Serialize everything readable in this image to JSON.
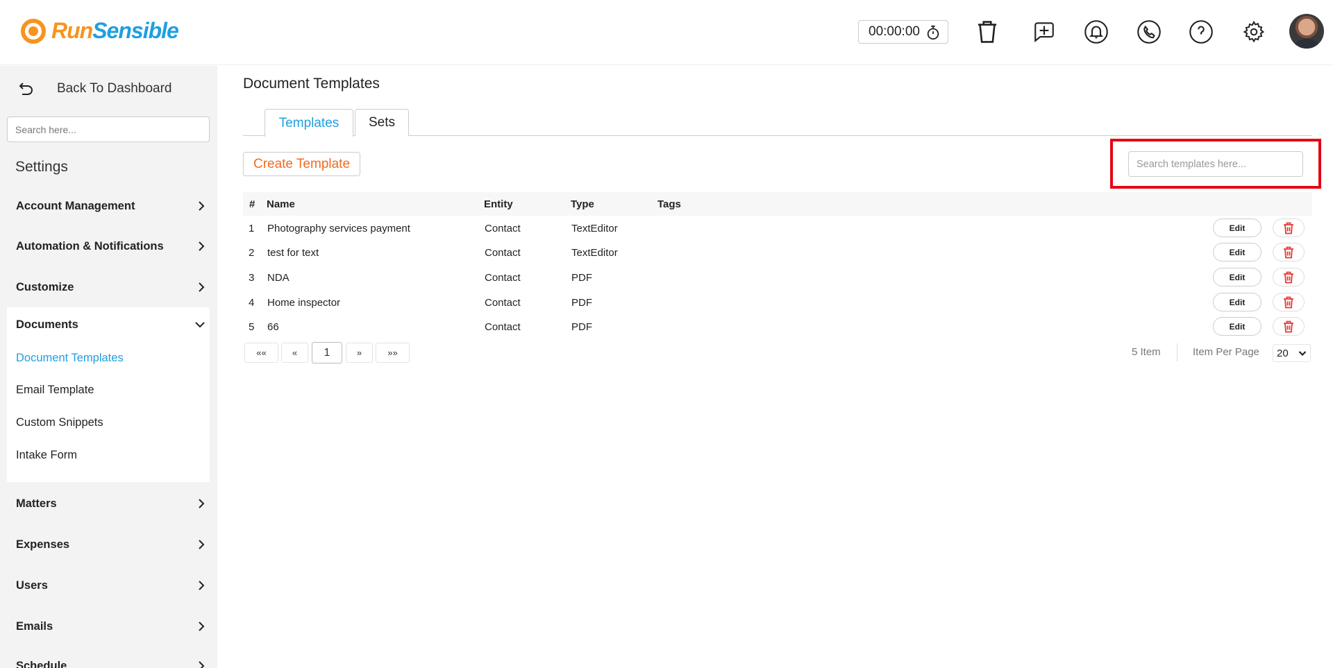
{
  "brand": {
    "part1": "Run",
    "part2": "Sensible"
  },
  "header": {
    "timer": "00:00:00"
  },
  "sidebar": {
    "back_label": "Back To Dashboard",
    "search_placeholder": "Search here...",
    "title": "Settings",
    "items": [
      {
        "label": "Account Management"
      },
      {
        "label": "Automation & Notifications"
      },
      {
        "label": "Customize"
      },
      {
        "label": "Documents"
      },
      {
        "label": "Matters"
      },
      {
        "label": "Expenses"
      },
      {
        "label": "Users"
      },
      {
        "label": "Emails"
      },
      {
        "label": "Schedule"
      }
    ],
    "documents_sub": [
      {
        "label": "Document Templates",
        "active": true
      },
      {
        "label": "Email Template"
      },
      {
        "label": "Custom Snippets"
      },
      {
        "label": "Intake Form"
      }
    ]
  },
  "main": {
    "title": "Document Templates",
    "tabs": [
      {
        "label": "Templates",
        "active": true
      },
      {
        "label": "Sets"
      }
    ],
    "create_label": "Create Template",
    "search_placeholder": "Search templates here...",
    "columns": {
      "num": "#",
      "name": "Name",
      "entity": "Entity",
      "type": "Type",
      "tags": "Tags"
    },
    "rows": [
      {
        "num": "1",
        "name": "Photography services payment",
        "entity": "Contact",
        "type": "TextEditor",
        "tags": ""
      },
      {
        "num": "2",
        "name": "test for text",
        "entity": "Contact",
        "type": "TextEditor",
        "tags": ""
      },
      {
        "num": "3",
        "name": "NDA",
        "entity": "Contact",
        "type": "PDF",
        "tags": ""
      },
      {
        "num": "4",
        "name": "Home inspector",
        "entity": "Contact",
        "type": "PDF",
        "tags": ""
      },
      {
        "num": "5",
        "name": "66",
        "entity": "Contact",
        "type": "PDF",
        "tags": ""
      }
    ],
    "edit_label": "Edit",
    "pagination": {
      "first": "««",
      "prev": "«",
      "current": "1",
      "next": "»",
      "last": "»»",
      "item_count": "5 Item",
      "per_page_label": "Item Per Page",
      "per_page_value": "20"
    }
  },
  "colors": {
    "accent": "#1e9fe0",
    "orange": "#f26b21",
    "highlight": "#e30613",
    "delete": "#e53935"
  }
}
